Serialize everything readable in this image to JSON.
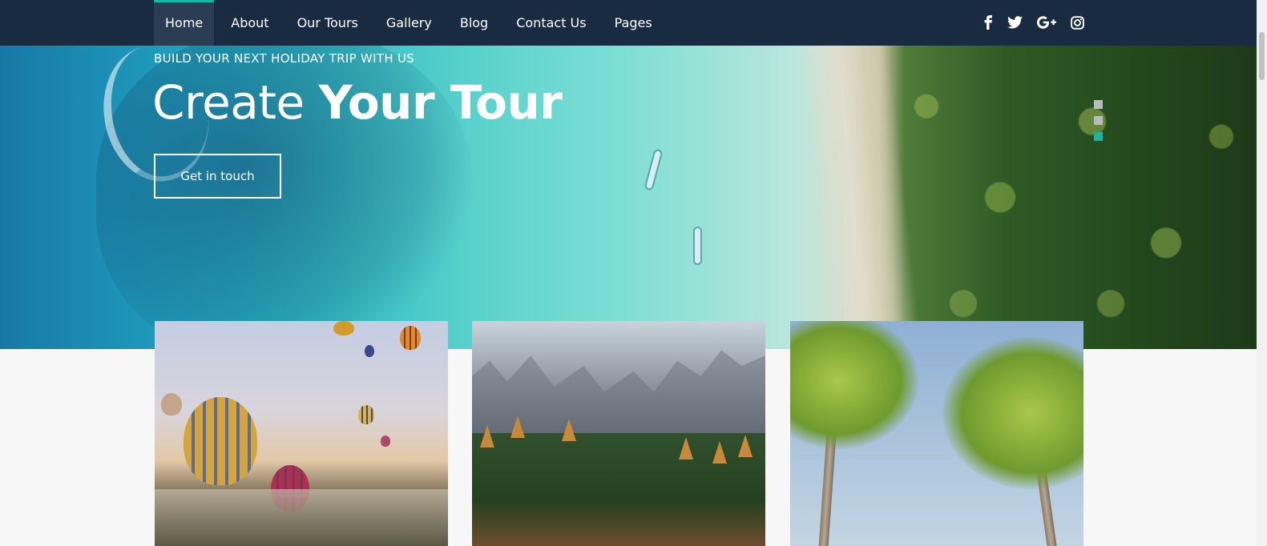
{
  "nav": {
    "items": [
      {
        "label": "Home",
        "active": true
      },
      {
        "label": "About",
        "active": false
      },
      {
        "label": "Our Tours",
        "active": false
      },
      {
        "label": "Gallery",
        "active": false
      },
      {
        "label": "Blog",
        "active": false
      },
      {
        "label": "Contact Us",
        "active": false
      },
      {
        "label": "Pages",
        "active": false
      }
    ],
    "social": [
      "facebook-icon",
      "twitter-icon",
      "google-plus-icon",
      "instagram-icon"
    ],
    "colors": {
      "background": "#182b41",
      "active_background": "#2b3d52",
      "accent": "#14b7a6"
    }
  },
  "hero": {
    "eyebrow": "BUILD YOUR NEXT HOLIDAY TRIP WITH US",
    "title_light": "Create ",
    "title_bold": "Your Tour",
    "cta_label": "Get in touch",
    "slider": {
      "slides": 3,
      "active_index": 2,
      "dot_color": "#b9bcbe",
      "active_dot_color": "#14b7a6"
    }
  },
  "cards": [
    {
      "image": "hot-air-balloons"
    },
    {
      "image": "mountain-forest"
    },
    {
      "image": "palm-trees"
    }
  ]
}
